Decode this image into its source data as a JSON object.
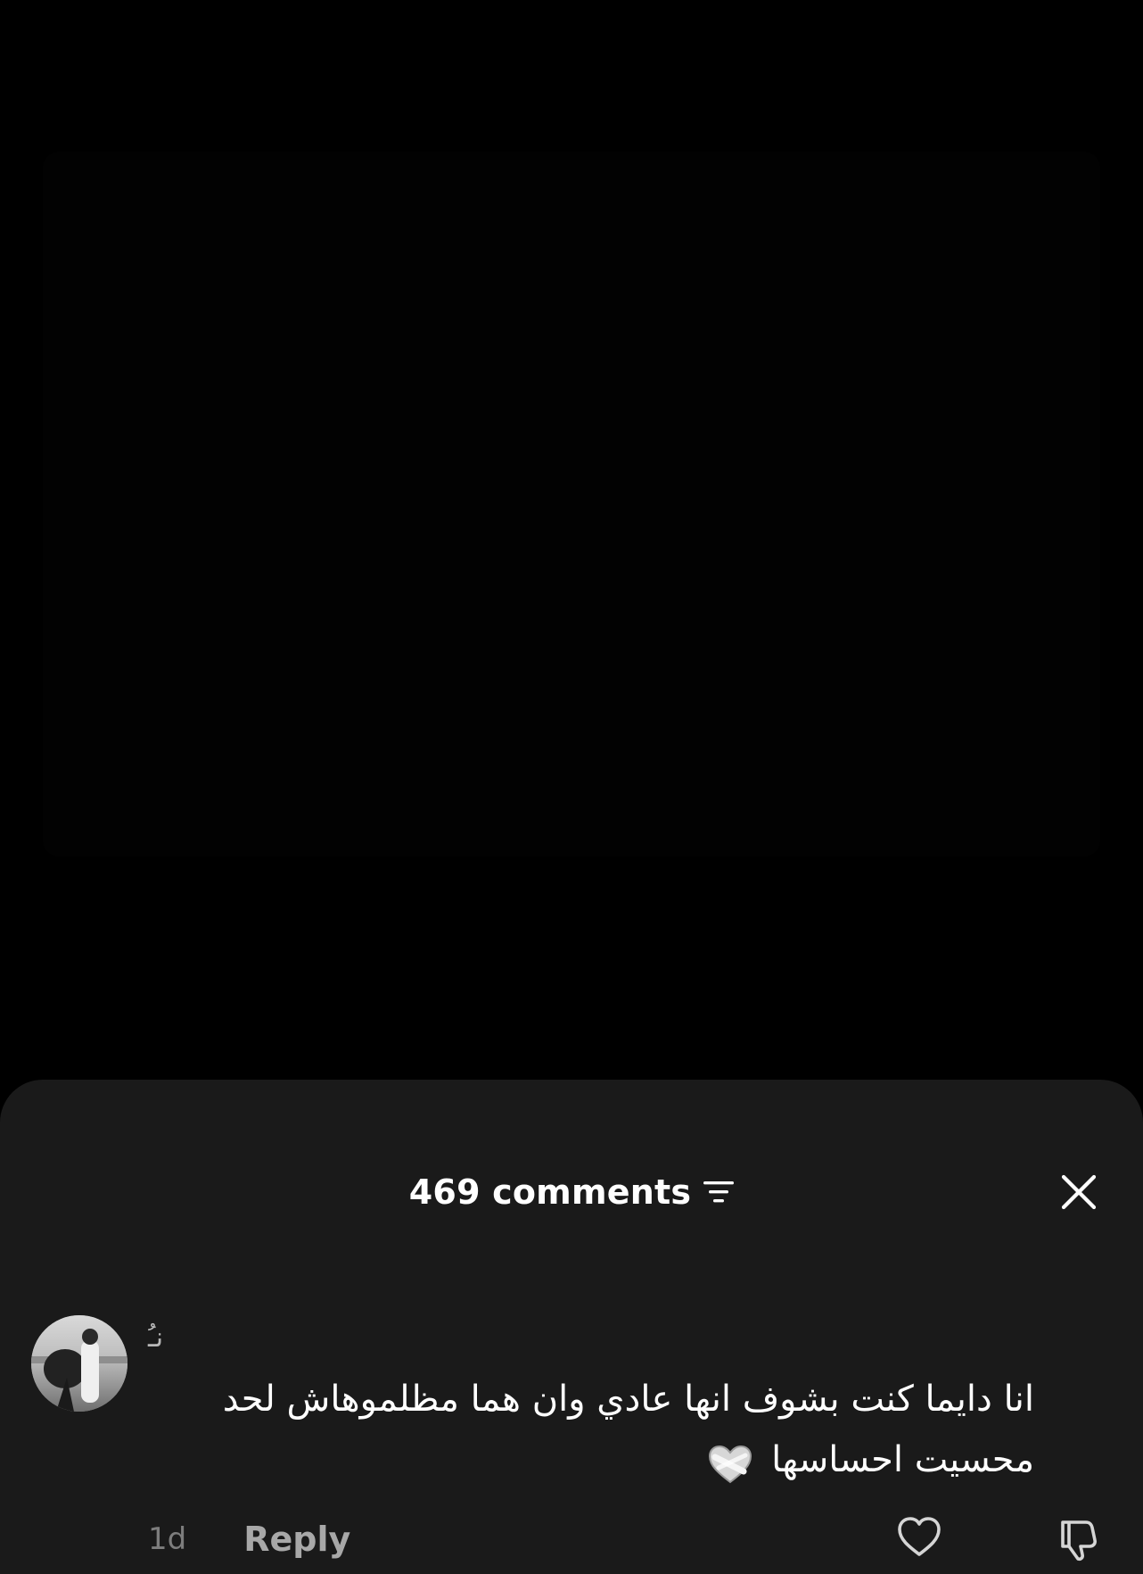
{
  "sheet": {
    "comment_count_label": "469 comments",
    "sort_icon": "sort-filter-icon",
    "close_icon": "close-icon"
  },
  "comments": [
    {
      "username": "نـُ",
      "text": "انا دايما كنت بشوف انها عادي وان هما مظلموهاش لحد محسيت احساسها",
      "emoji_icon": "mending-heart-icon",
      "timestamp": "1d",
      "reply_label": "Reply",
      "like_icon": "heart-outline-icon",
      "dislike_icon": "thumbs-down-icon"
    }
  ],
  "colors": {
    "background": "#000000",
    "sheet": "#1a1a1a",
    "primary_text": "#ffffff",
    "secondary_text": "#7d7d7d",
    "reply_text": "#a8a8a8"
  }
}
